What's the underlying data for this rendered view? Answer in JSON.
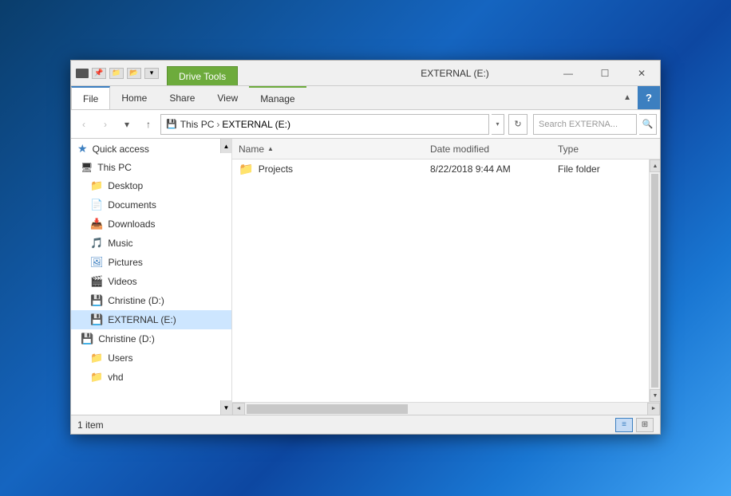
{
  "window": {
    "title": "EXTERNAL (E:)",
    "drive_tools_tab": "Drive Tools",
    "controls": {
      "minimize": "—",
      "maximize": "☐",
      "close": "✕"
    }
  },
  "ribbon": {
    "tabs": [
      {
        "id": "file",
        "label": "File"
      },
      {
        "id": "home",
        "label": "Home"
      },
      {
        "id": "share",
        "label": "Share"
      },
      {
        "id": "view",
        "label": "View"
      },
      {
        "id": "manage",
        "label": "Manage"
      }
    ],
    "help": "?"
  },
  "addressbar": {
    "back_btn": "‹",
    "forward_btn": "›",
    "recent_btn": "▾",
    "up_btn": "↑",
    "drive_icon": "💾",
    "crumbs": [
      "This PC",
      "EXTERNAL (E:)"
    ],
    "dropdown": "▾",
    "refresh": "↻",
    "search_placeholder": "Search EXTERNA...",
    "search_icon": "🔍"
  },
  "sidebar": {
    "quick_access": {
      "label": "Quick access",
      "icon": "★"
    },
    "this_pc": {
      "label": "This PC",
      "icon": "🖥"
    },
    "items": [
      {
        "id": "desktop",
        "label": "Desktop",
        "icon": "folder-blue",
        "indent": 1
      },
      {
        "id": "documents",
        "label": "Documents",
        "icon": "folder-blue",
        "indent": 1
      },
      {
        "id": "downloads",
        "label": "Downloads",
        "icon": "folder-down",
        "indent": 1
      },
      {
        "id": "music",
        "label": "Music",
        "icon": "music",
        "indent": 1
      },
      {
        "id": "pictures",
        "label": "Pictures",
        "icon": "folder-blue",
        "indent": 1
      },
      {
        "id": "videos",
        "label": "Videos",
        "icon": "folder-blue",
        "indent": 1
      },
      {
        "id": "christine-d",
        "label": "Christine (D:)",
        "icon": "drive",
        "indent": 1
      },
      {
        "id": "external-e",
        "label": "EXTERNAL (E:)",
        "icon": "drive",
        "indent": 1,
        "selected": true
      }
    ],
    "christine_d2": {
      "label": "Christine (D:)",
      "icon": "drive"
    },
    "sub_items": [
      {
        "id": "users",
        "label": "Users",
        "icon": "folder-yellow",
        "indent": 2
      },
      {
        "id": "vhd",
        "label": "vhd",
        "icon": "folder-yellow",
        "indent": 2
      }
    ]
  },
  "file_list": {
    "columns": {
      "name": "Name",
      "date_modified": "Date modified",
      "type": "Type"
    },
    "sort_arrow": "▲",
    "files": [
      {
        "name": "Projects",
        "date_modified": "8/22/2018 9:44 AM",
        "type": "File folder",
        "icon": "folder"
      }
    ]
  },
  "status_bar": {
    "item_count": "1 item",
    "view_details": "≡",
    "view_tiles": "⊞"
  }
}
